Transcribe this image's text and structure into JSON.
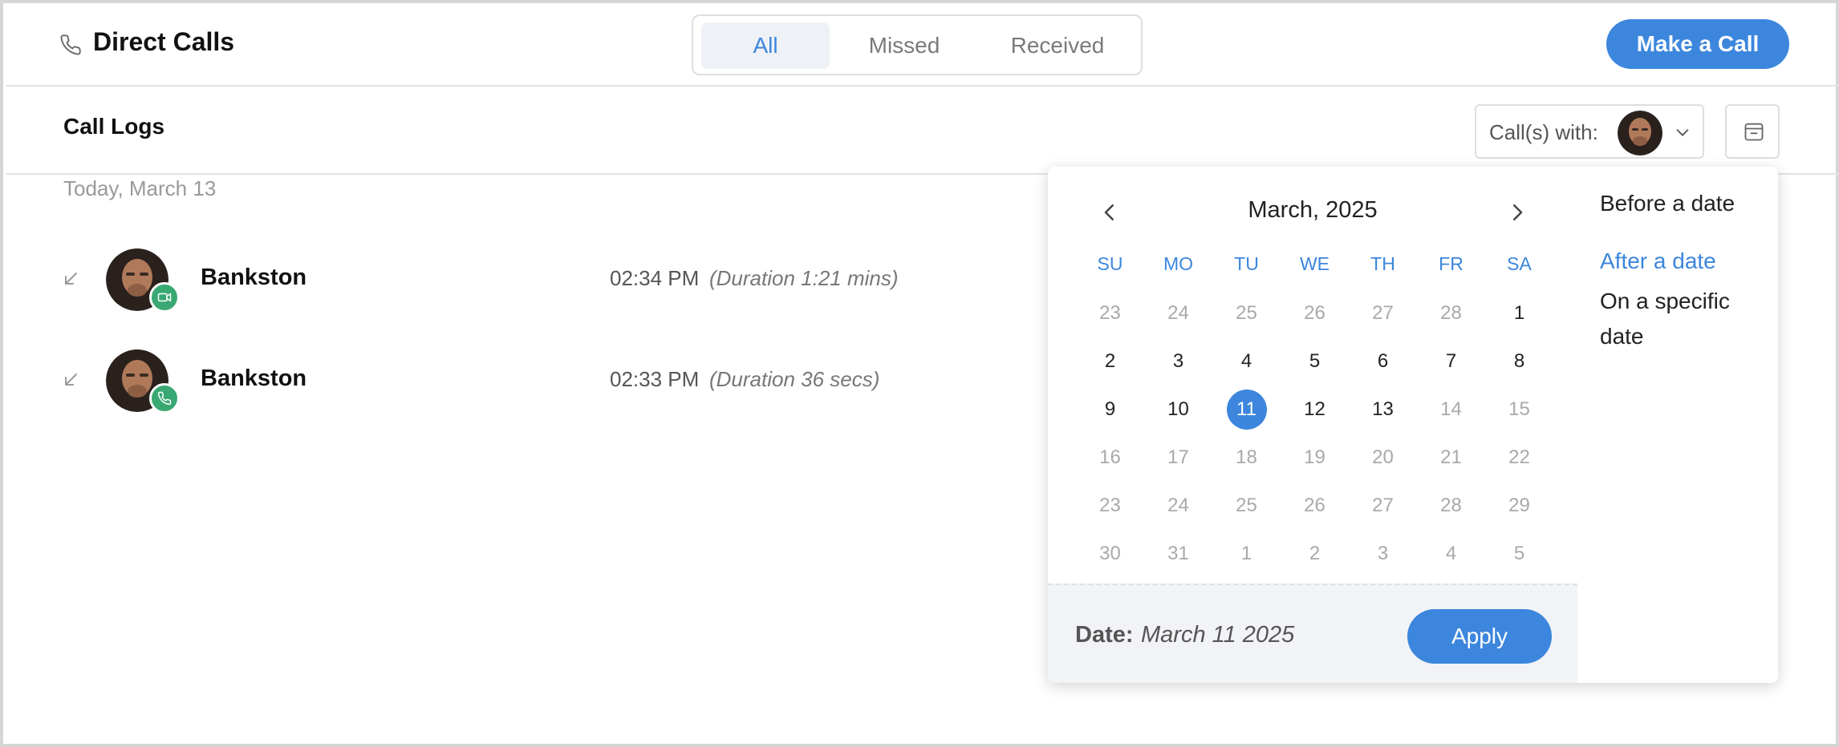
{
  "header": {
    "title": "Direct Calls",
    "tabs": [
      {
        "label": "All",
        "active": true
      },
      {
        "label": "Missed",
        "active": false
      },
      {
        "label": "Received",
        "active": false
      }
    ],
    "make_call_label": "Make a Call"
  },
  "subheader": {
    "title": "Call Logs",
    "calls_with_label": "Call(s) with:"
  },
  "logs": {
    "group_label": "Today, March 13",
    "items": [
      {
        "name": "Bankston",
        "time": "02:34 PM",
        "duration": "(Duration 1:21 mins)",
        "type_icon": "video-icon",
        "direction_icon": "incoming-arrow-icon"
      },
      {
        "name": "Bankston",
        "time": "02:33 PM",
        "duration": "(Duration 36 secs)",
        "type_icon": "phone-icon",
        "direction_icon": "incoming-arrow-icon"
      }
    ]
  },
  "datepicker": {
    "month": "March, 2025",
    "weekdays": [
      "SU",
      "MO",
      "TU",
      "WE",
      "TH",
      "FR",
      "SA"
    ],
    "days": [
      [
        "23",
        "24",
        "25",
        "26",
        "27",
        "28",
        "1"
      ],
      [
        "2",
        "3",
        "4",
        "5",
        "6",
        "7",
        "8"
      ],
      [
        "9",
        "10",
        "11",
        "12",
        "13",
        "14",
        "15"
      ],
      [
        "16",
        "17",
        "18",
        "19",
        "20",
        "21",
        "22"
      ],
      [
        "23",
        "24",
        "25",
        "26",
        "27",
        "28",
        "29"
      ],
      [
        "30",
        "31",
        "1",
        "2",
        "3",
        "4",
        "5"
      ]
    ],
    "selected_day": "11",
    "footer_label": "Date:",
    "footer_value": "March 11 2025",
    "apply_label": "Apply",
    "options": [
      {
        "label": "Before a date",
        "active": false
      },
      {
        "label": "After a date",
        "active": true
      },
      {
        "label": "On a specific date",
        "active": false
      }
    ]
  },
  "colors": {
    "accent": "#3c86dd",
    "badge": "#3aa872",
    "muted_text": "#a9a9a9"
  }
}
